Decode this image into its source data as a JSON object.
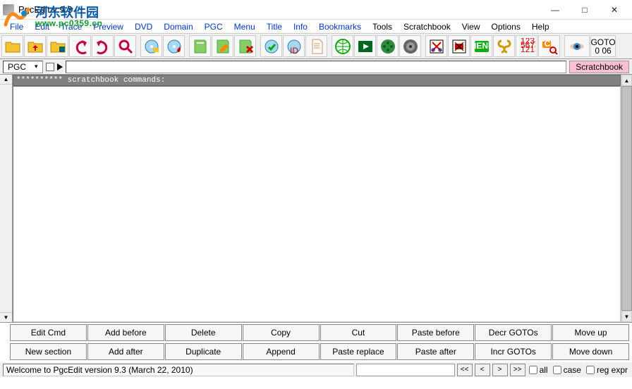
{
  "window": {
    "title": "PgcEdit v 9.3",
    "min": "—",
    "max": "□",
    "close": "✕"
  },
  "menu": {
    "items": [
      "File",
      "Edit",
      "Trace",
      "Preview",
      "DVD",
      "Domain",
      "PGC",
      "Menu",
      "Title",
      "Info",
      "Bookmarks",
      "Tools",
      "Scratchbook",
      "View",
      "Options",
      "Help"
    ],
    "dark_indices": [
      11,
      12,
      13,
      14,
      15
    ]
  },
  "watermark": {
    "cn": "河东软件园",
    "url": "www.pc0359.cn"
  },
  "toolbar": {
    "icons": [
      "open-folder",
      "import-folder",
      "save-folder",
      "undo",
      "redo",
      "find",
      "disc-open",
      "disc-burn",
      "book-green",
      "book-edit",
      "book-delete",
      "disc-check",
      "disc-id",
      "page",
      "globe",
      "play-tv",
      "film",
      "gear",
      "scissors",
      "cut-menu",
      "menu-green",
      "link",
      "numbers",
      "tcl-zoom",
      "eye",
      "goto"
    ],
    "goto_label": "GOTO",
    "goto_value": "0  06"
  },
  "subbar": {
    "pgc_label": "PGC",
    "scratchbook_label": "Scratchbook"
  },
  "editor": {
    "header": " ********** scratchbook commands:"
  },
  "commands_row1": [
    "Edit Cmd",
    "Add before",
    "Delete",
    "Copy",
    "Cut",
    "Paste before",
    "Decr GOTOs",
    "Move up"
  ],
  "commands_row2": [
    "New section",
    "Add after",
    "Duplicate",
    "Append",
    "Paste replace",
    "Paste after",
    "Incr GOTOs",
    "Move down"
  ],
  "status": {
    "message": "Welcome to PgcEdit version 9.3 (March 22, 2010)",
    "nav": [
      "<<",
      "<",
      ">",
      ">>"
    ],
    "all_label": "all",
    "case_label": "case",
    "regex_label": "reg expr"
  }
}
